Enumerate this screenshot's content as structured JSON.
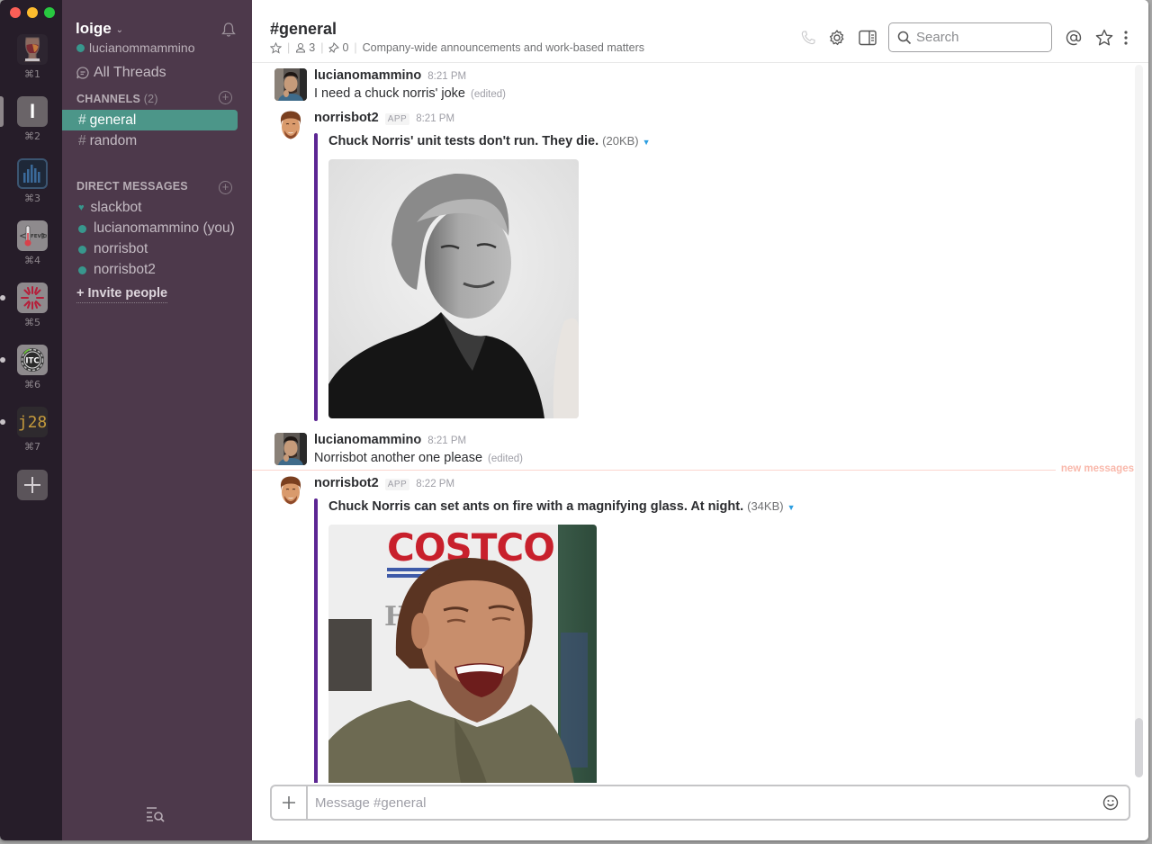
{
  "window": {
    "controls": [
      "close",
      "minimize",
      "maximize"
    ]
  },
  "teams": [
    {
      "shortcut": "⌘1",
      "icon": "glencairn-glass-icon",
      "active": false,
      "unread": false
    },
    {
      "shortcut": "⌘2",
      "icon": "letter-i-icon",
      "label": "I",
      "active": true,
      "unread": false
    },
    {
      "shortcut": "⌘3",
      "icon": "bar-chart-icon",
      "active": false,
      "unread": false
    },
    {
      "shortcut": "⌘4",
      "icon": "thermometer-fevr-icon",
      "label": "FEVR",
      "active": false,
      "unread": false
    },
    {
      "shortcut": "⌘5",
      "icon": "starburst-icon",
      "active": false,
      "unread": true
    },
    {
      "shortcut": "⌘6",
      "icon": "itc-badge-icon",
      "label": "ITC",
      "active": false,
      "unread": true
    },
    {
      "shortcut": "⌘7",
      "icon": "j28-icon",
      "label": "j28",
      "active": false,
      "unread": true
    }
  ],
  "sidebar": {
    "team_name": "loige",
    "user_name": "lucianommammino",
    "all_threads": "All Threads",
    "channels_label": "CHANNELS",
    "channels_count": "(2)",
    "channels": [
      {
        "name": "general",
        "active": true
      },
      {
        "name": "random",
        "active": false
      }
    ],
    "dm_label": "DIRECT MESSAGES",
    "dms": [
      {
        "name": "slackbot",
        "presence": "heart"
      },
      {
        "name": "lucianomammino (you)",
        "presence": "online"
      },
      {
        "name": "norrisbot",
        "presence": "online"
      },
      {
        "name": "norrisbot2",
        "presence": "online"
      }
    ],
    "invite": "+ Invite people"
  },
  "header": {
    "channel_title": "#general",
    "members": "3",
    "pins": "0",
    "topic": "Company-wide announcements and work-based matters",
    "search_placeholder": "Search"
  },
  "messages": [
    {
      "sender": "lucianomammino",
      "time": "8:21 PM",
      "text": "I need a chuck norris' joke",
      "edited": "(edited)",
      "app": false
    },
    {
      "sender": "norrisbot2",
      "app_badge": "APP",
      "time": "8:21 PM",
      "attachment_title": "Chuck Norris' unit tests don't run. They die.",
      "attachment_size": "(20KB)",
      "image": "chuck-norris-young-bw-photo"
    },
    {
      "sender": "lucianomammino",
      "time": "8:21 PM",
      "text": "Norrisbot another one please",
      "edited": "(edited)",
      "app": false
    },
    {
      "sender": "norrisbot2",
      "app_badge": "APP",
      "time": "8:22 PM",
      "attachment_title": "Chuck Norris can set ants on fire with a magnifying glass. At night.",
      "attachment_size": "(34KB)",
      "image": "chuck-norris-laughing-photo"
    }
  ],
  "new_messages_label": "new messages",
  "composer": {
    "placeholder": "Message #general"
  },
  "colors": {
    "sidebar_bg": "#4d394b",
    "team_bar_bg": "#261d29",
    "active_channel": "#4c9689",
    "presence": "#38978d",
    "attachment_bar": "#5c2693",
    "new_messages": "#f9b8ab"
  }
}
